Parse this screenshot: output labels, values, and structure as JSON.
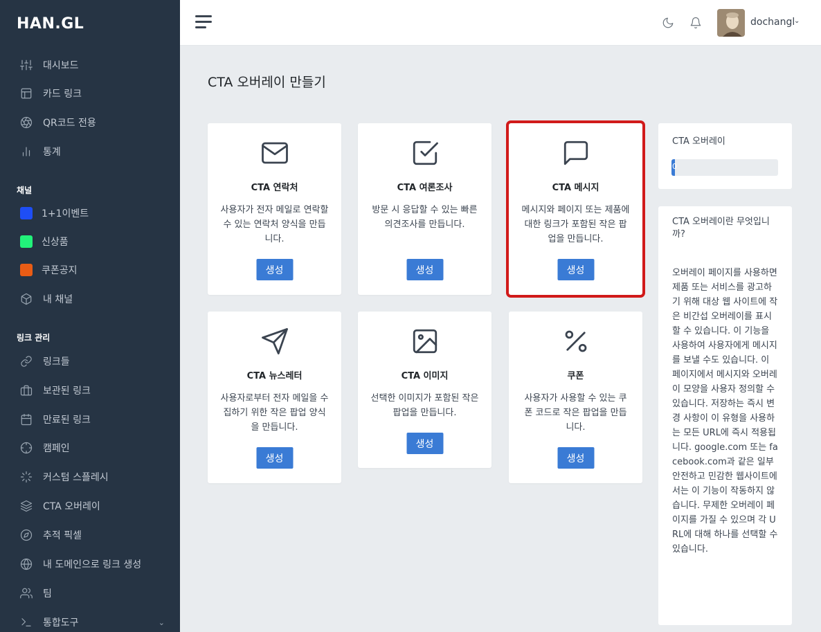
{
  "logo": "HAN.GL",
  "sidebar": {
    "items": [
      {
        "label": "대시보드",
        "icon": "sliders-icon"
      },
      {
        "label": "카드 링크",
        "icon": "layout-icon"
      },
      {
        "label": "QR코드 전용",
        "icon": "aperture-icon"
      },
      {
        "label": "통계",
        "icon": "bar-chart-icon"
      }
    ],
    "channels_label": "채널",
    "channels": [
      {
        "label": "1+1이벤트",
        "color": "#1e4ef5"
      },
      {
        "label": "신상품",
        "color": "#22f27a"
      },
      {
        "label": "쿠폰공지",
        "color": "#e95c15"
      },
      {
        "label": "내 채널",
        "icon": "box-icon"
      }
    ],
    "links_label": "링크 관리",
    "links": [
      {
        "label": "링크들",
        "icon": "link-icon"
      },
      {
        "label": "보관된 링크",
        "icon": "briefcase-icon"
      },
      {
        "label": "만료된 링크",
        "icon": "calendar-icon"
      },
      {
        "label": "캠페인",
        "icon": "crosshair-icon"
      },
      {
        "label": "커스텀 스플레시",
        "icon": "loader-icon"
      },
      {
        "label": "CTA 오버레이",
        "icon": "layers-icon"
      },
      {
        "label": "추적 픽셀",
        "icon": "compass-icon"
      },
      {
        "label": "내 도메인으로 링크 생성",
        "icon": "globe-icon"
      },
      {
        "label": "팀",
        "icon": "users-icon"
      },
      {
        "label": "통합도구",
        "icon": "terminal-icon"
      }
    ]
  },
  "header": {
    "username": "dochangl",
    "user_chevron": "⌄"
  },
  "page": {
    "title": "CTA 오버레이 만들기"
  },
  "cards": [
    {
      "title": "CTA 연락처",
      "desc": "사용자가 전자 메일로 연락할 수 있는 연락처 양식을 만듭니다.",
      "button": "생성"
    },
    {
      "title": "CTA 여론조사",
      "desc": "방문 시 응답할 수 있는 빠른 의견조사를 만듭니다.",
      "button": "생성"
    },
    {
      "title": "CTA 메시지",
      "desc": "메시지와 페이지 또는 제품에 대한 링크가 포함된 작은 팝업을 만듭니다.",
      "button": "생성"
    },
    {
      "title": "CTA 뉴스레터",
      "desc": "사용자로부터 전자 메일을 수집하기 위한 작은 팝업 양식을 만듭니다.",
      "button": "생성"
    },
    {
      "title": "CTA 이미지",
      "desc": "선택한 이미지가 포함된 작은 팝업을 만듭니다.",
      "button": "생성"
    },
    {
      "title": "쿠폰",
      "desc": "사용자가 사용할 수 있는 쿠폰 코드로 작은 팝업을 만듭니다.",
      "button": "생성"
    }
  ],
  "usage": {
    "title": "CTA 오버레이",
    "progress_value": 0,
    "progress_text": "0"
  },
  "info": {
    "title": "CTA 오버레이란 무엇입니까?",
    "body": "오버레이 페이지를 사용하면 제품 또는 서비스를 광고하기 위해 대상 웹 사이트에 작은 비간섭 오버레이를 표시할 수 있습니다. 이 기능을 사용하여 사용자에게 메시지를 보낼 수도 있습니다. 이 페이지에서 메시지와 오버레이 모양을 사용자 정의할 수 있습니다. 저장하는 즉시 변경 사항이 이 유형을 사용하는 모든 URL에 즉시 적용됩니다. google.com 또는 facebook.com과 같은 일부 안전하고 민감한 웹사이트에서는 이 기능이 작동하지 않습니다. 무제한 오버레이 페이지를 가질 수 있으며 각 URL에 대해 하나를 선택할 수 있습니다."
  },
  "colors": {
    "sidebar_bg": "#263444",
    "button_blue": "#3a7bd5",
    "highlight_red": "#d11a1a"
  }
}
